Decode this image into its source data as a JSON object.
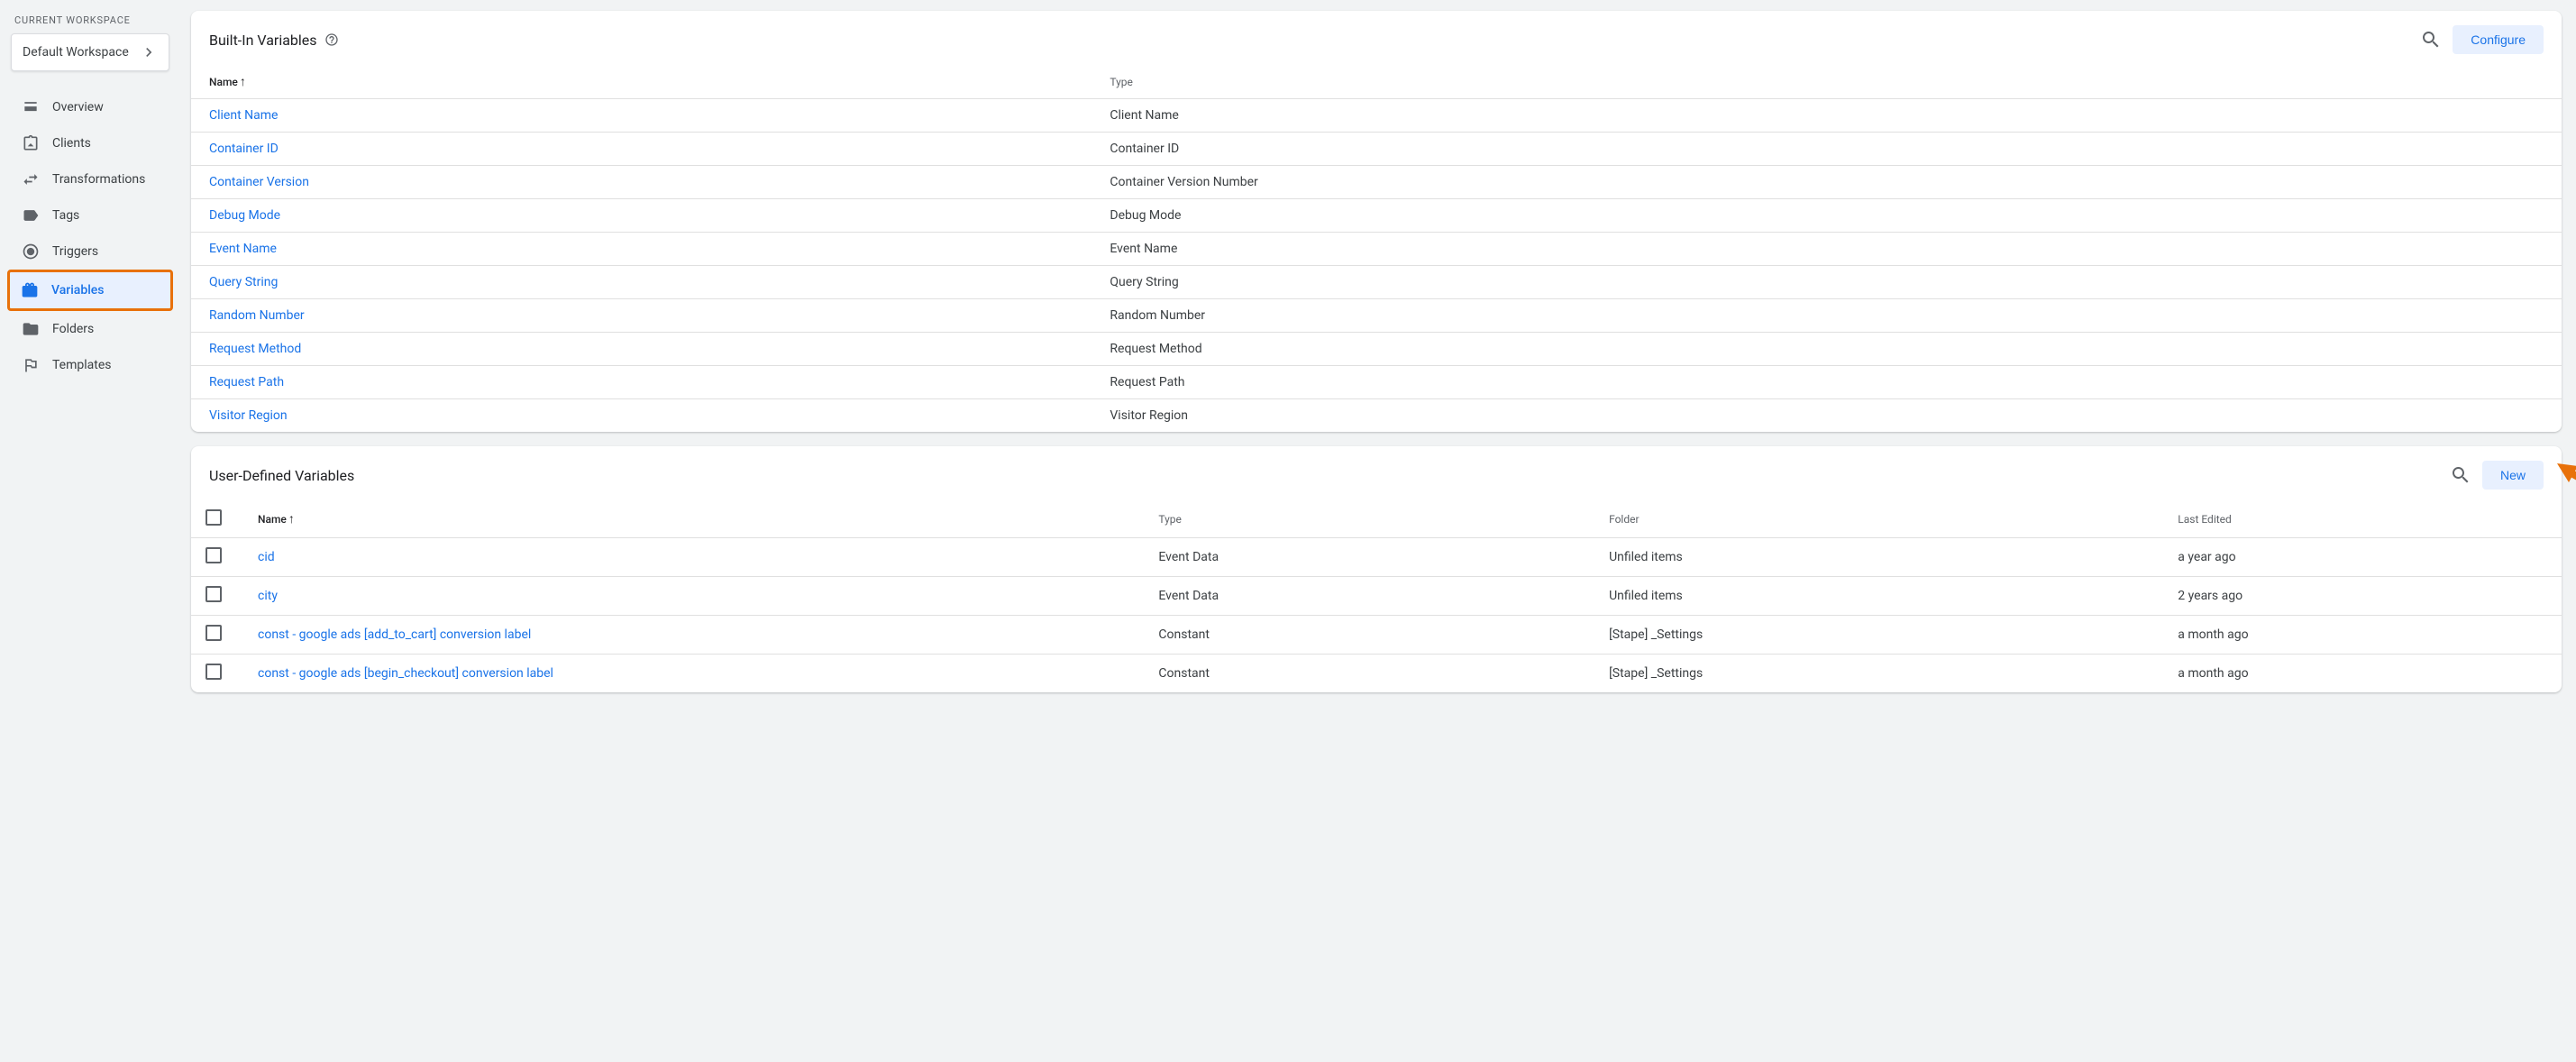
{
  "sidebar": {
    "current_workspace_label": "CURRENT WORKSPACE",
    "workspace_name": "Default Workspace",
    "nav_items": [
      {
        "label": "Overview",
        "icon": "overview"
      },
      {
        "label": "Clients",
        "icon": "clients"
      },
      {
        "label": "Transformations",
        "icon": "transformations"
      },
      {
        "label": "Tags",
        "icon": "tags"
      },
      {
        "label": "Triggers",
        "icon": "triggers"
      },
      {
        "label": "Variables",
        "icon": "variables",
        "active": true
      },
      {
        "label": "Folders",
        "icon": "folders"
      },
      {
        "label": "Templates",
        "icon": "templates"
      }
    ]
  },
  "builtin": {
    "title": "Built-In Variables",
    "configure_label": "Configure",
    "columns": {
      "name": "Name",
      "type": "Type"
    },
    "rows": [
      {
        "name": "Client Name",
        "type": "Client Name"
      },
      {
        "name": "Container ID",
        "type": "Container ID"
      },
      {
        "name": "Container Version",
        "type": "Container Version Number"
      },
      {
        "name": "Debug Mode",
        "type": "Debug Mode"
      },
      {
        "name": "Event Name",
        "type": "Event Name"
      },
      {
        "name": "Query String",
        "type": "Query String"
      },
      {
        "name": "Random Number",
        "type": "Random Number"
      },
      {
        "name": "Request Method",
        "type": "Request Method"
      },
      {
        "name": "Request Path",
        "type": "Request Path"
      },
      {
        "name": "Visitor Region",
        "type": "Visitor Region"
      }
    ]
  },
  "user_defined": {
    "title": "User-Defined Variables",
    "new_label": "New",
    "columns": {
      "name": "Name",
      "type": "Type",
      "folder": "Folder",
      "last_edited": "Last Edited"
    },
    "rows": [
      {
        "name": "cid",
        "type": "Event Data",
        "folder": "Unfiled items",
        "last_edited": "a year ago"
      },
      {
        "name": "city",
        "type": "Event Data",
        "folder": "Unfiled items",
        "last_edited": "2 years ago"
      },
      {
        "name": "const - google ads [add_to_cart] conversion label",
        "type": "Constant",
        "folder": "[Stape] _Settings",
        "last_edited": "a month ago"
      },
      {
        "name": "const - google ads [begin_checkout] conversion label",
        "type": "Constant",
        "folder": "[Stape] _Settings",
        "last_edited": "a month ago"
      }
    ]
  }
}
